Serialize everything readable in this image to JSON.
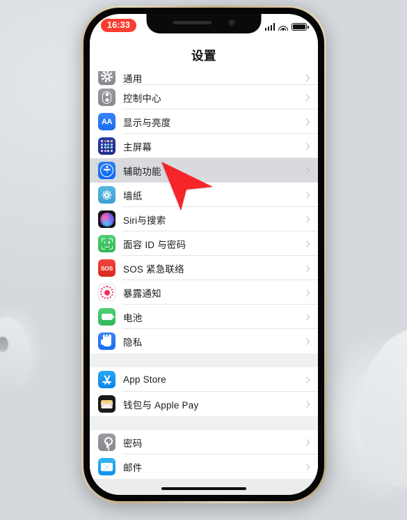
{
  "device": {
    "frame_color": "#cdb793",
    "screen_bg": "#ffffff"
  },
  "status_bar": {
    "time": "16:33",
    "time_badge_color": "#fb3b30",
    "icons": [
      "cellular-signal-icon",
      "wifi-icon",
      "battery-icon"
    ]
  },
  "nav": {
    "title": "设置"
  },
  "settings": {
    "selected_row": "辅助功能",
    "selected_bg": "#d9dade",
    "groups": [
      {
        "rows": [
          {
            "label": "通用",
            "icon": "gear-icon",
            "clipped": true
          },
          {
            "label": "控制中心",
            "icon": "control-center-icon"
          },
          {
            "label": "显示与亮度",
            "icon": "display-brightness-icon"
          },
          {
            "label": "主屏幕",
            "icon": "home-screen-icon"
          },
          {
            "label": "辅助功能",
            "icon": "accessibility-icon",
            "selected": true
          },
          {
            "label": "墙纸",
            "icon": "wallpaper-icon"
          },
          {
            "label": "Siri与搜索",
            "icon": "siri-icon"
          },
          {
            "label": "面容 ID 与密码",
            "icon": "face-id-icon"
          },
          {
            "label": "SOS 紧急联络",
            "icon": "emergency-sos-icon"
          },
          {
            "label": "暴露通知",
            "icon": "exposure-notification-icon"
          },
          {
            "label": "电池",
            "icon": "battery-settings-icon"
          },
          {
            "label": "隐私",
            "icon": "privacy-icon"
          }
        ]
      },
      {
        "rows": [
          {
            "label": "App Store",
            "icon": "app-store-icon"
          },
          {
            "label": "钱包与 Apple Pay",
            "icon": "wallet-icon"
          }
        ]
      },
      {
        "rows": [
          {
            "label": "密码",
            "icon": "passwords-icon"
          },
          {
            "label": "邮件",
            "icon": "mail-icon"
          }
        ]
      }
    ]
  },
  "cursor": {
    "color": "#f5252a",
    "points_at": "辅助功能"
  }
}
